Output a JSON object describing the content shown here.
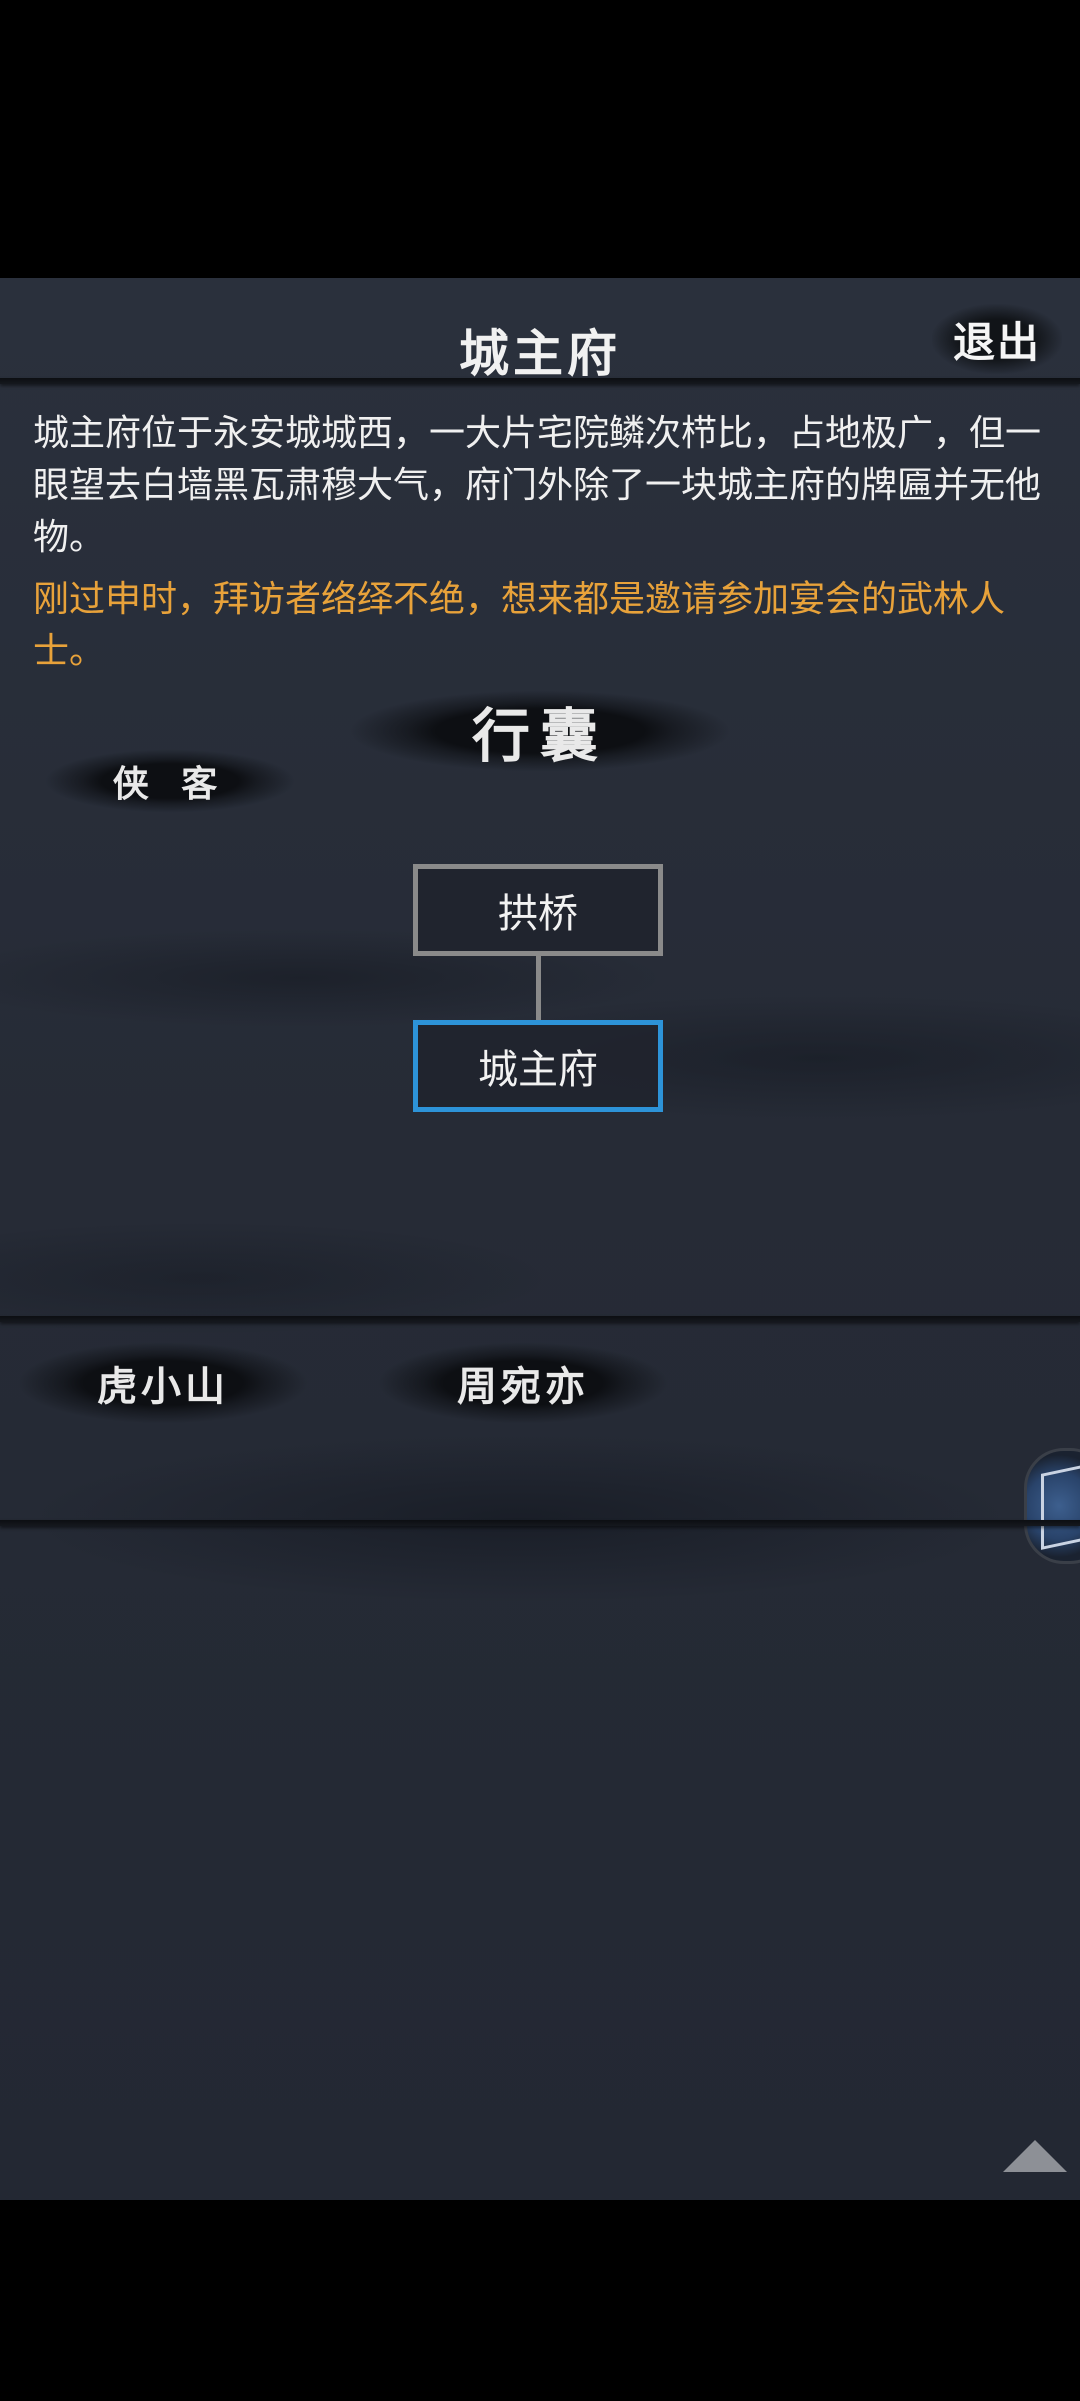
{
  "header": {
    "title": "城主府",
    "exit_label": "退出"
  },
  "description": {
    "main": "城主府位于永安城城西，一大片宅院鳞次栉比，占地极广，但一眼望去白墙黑瓦肃穆大气，府门外除了一块城主府的牌匾并无他物。",
    "event": "刚过申时，拜访者络绎不绝，想来都是邀请参加宴会的武林人士。"
  },
  "menu": {
    "bag_label": "行囊",
    "hero_label": "侠 客"
  },
  "map": {
    "nodes": [
      {
        "label": "拱桥",
        "state": "normal"
      },
      {
        "label": "城主府",
        "state": "current"
      }
    ],
    "current_color": "#2d93d8"
  },
  "npcs": [
    {
      "name": "虎小山"
    },
    {
      "name": "周宛亦"
    }
  ],
  "icons": {
    "side_item": "blue-book-icon",
    "scroll": "triangle-up-icon"
  }
}
